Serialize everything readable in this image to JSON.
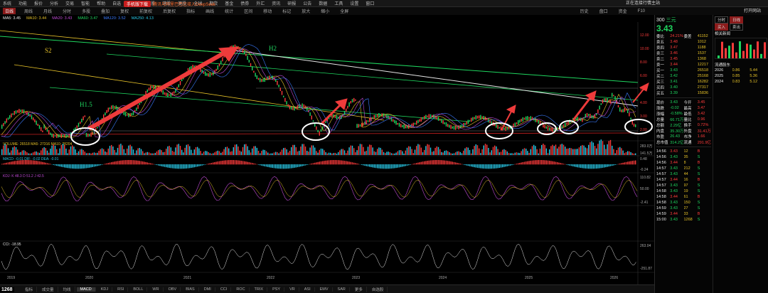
{
  "menubar": {
    "items": [
      "系统",
      "功能",
      "报价",
      "分析",
      "交易",
      "智能",
      "帮助",
      "自选",
      "沪深京",
      "A股",
      "港股",
      "美股",
      "全球",
      "期货",
      "基金",
      "债券",
      "外汇",
      "资讯",
      "研报",
      "公告",
      "数据",
      "工具",
      "设置",
      "窗口"
    ],
    "news_pill": "手机版下载",
    "news_text": "腾讯与阿里巴巴已接入DeepSeek",
    "window_title": "正在连接行情主站"
  },
  "toolbar": {
    "items": [
      "日线",
      "周线",
      "月线",
      "分时",
      "多股",
      "叠加",
      "复权",
      "前复权",
      "后复权",
      "指标",
      "画线",
      "统计",
      "区间",
      "移动",
      "标记",
      "放大",
      "缩小",
      "全屏"
    ],
    "active": "日线",
    "right_items": [
      "历史",
      "盘口",
      "资金",
      "F10"
    ],
    "right_title": "打开网站"
  },
  "ma_strip": [
    {
      "label": "MA5: 3.45",
      "color": "#e8e8e8"
    },
    {
      "label": "MA10: 3.44",
      "color": "#e6c229"
    },
    {
      "label": "MA20: 3.43",
      "color": "#c04bd6"
    },
    {
      "label": "MA60: 3.47",
      "color": "#1fd65f"
    },
    {
      "label": "MA120: 3.52",
      "color": "#3a7bff"
    },
    {
      "label": "MA250: 4.13",
      "color": "#29c7e6"
    }
  ],
  "chart_labels": {
    "s2": "S2",
    "h2": "H2",
    "h15": "H1.5"
  },
  "x_axis": [
    "2019",
    "2020",
    "2021",
    "2022",
    "2023",
    "2024",
    "2025",
    "2026"
  ],
  "price_axis": [
    "12.00",
    "10.00",
    "8.00",
    "6.00",
    "5.00",
    "4.00",
    "3.00",
    "2.00"
  ],
  "panel_labels": {
    "vol": "VOLUME: 26518  MA5: 27316  MA10: 28204",
    "macd": "MACD: -0.01  DIF: -0.02  DEA: -0.01",
    "kdj": "KDJ: K 48.3  D 51.2  J 42.5",
    "cci": "CCI: -18.95"
  },
  "panel_axes": {
    "vol": [
      "283.0万",
      "141.5万"
    ],
    "macd": [
      "0.48",
      "-0.24"
    ],
    "kdj": [
      "110.82",
      "50.00",
      "-2.41"
    ],
    "cci": [
      "263.04",
      "-251.87"
    ]
  },
  "bottom_tabs": [
    "指标",
    "成交量",
    "均线",
    "MACD",
    "KDJ",
    "RSI",
    "BOLL",
    "WR",
    "OBV",
    "BIAS",
    "DMI",
    "CCI",
    "ROC",
    "TRIX",
    "PSY",
    "VR",
    "ASI",
    "EMV",
    "SAR",
    "更多",
    "自选股"
  ],
  "bottom_active": "MACD",
  "code_tag": "1268",
  "side": {
    "code": "300",
    "name": "三元",
    "price": "3.43",
    "rows_a": [
      [
        "委比",
        "24.21%",
        "委差",
        "41152"
      ],
      [
        "卖五",
        "3.48",
        "",
        "1012"
      ],
      [
        "卖四",
        "3.47",
        "",
        "1188"
      ],
      [
        "卖三",
        "3.46",
        "",
        "1537"
      ],
      [
        "卖二",
        "3.45",
        "",
        "1368"
      ],
      [
        "卖一",
        "3.44",
        "",
        "12217"
      ],
      [
        "买一",
        "3.43",
        "",
        "26518"
      ],
      [
        "买二",
        "3.42",
        "",
        "25168"
      ],
      [
        "买三",
        "3.41",
        "",
        "16282"
      ],
      [
        "买四",
        "3.40",
        "",
        "27317"
      ],
      [
        "买五",
        "3.39",
        "",
        "15836"
      ]
    ],
    "quote_rows": [
      [
        "现价",
        "3.43",
        "今开",
        "3.45"
      ],
      [
        "涨跌",
        "-0.02",
        "最高",
        "3.47"
      ],
      [
        "涨幅",
        "-0.58%",
        "最低",
        "3.42"
      ],
      [
        "总量",
        "66.71万",
        "量比",
        "0.96"
      ],
      [
        "总额",
        "2.29亿",
        "换手",
        "0.72%"
      ],
      [
        "内盘",
        "35.30万",
        "外盘",
        "31.41万"
      ],
      [
        "市盈",
        "26.43",
        "市净",
        "1.66"
      ],
      [
        "总市值",
        "314.2亿",
        "流通",
        "291.9亿"
      ]
    ],
    "fin_rows": [
      [
        "2026",
        "0.86",
        "5.44"
      ],
      [
        "2025",
        "0.85",
        "5.36"
      ],
      [
        "2024",
        "0.83",
        "5.12"
      ]
    ],
    "ticks": [
      [
        "14:56",
        "3.43",
        "12",
        "B"
      ],
      [
        "14:56",
        "3.43",
        "35",
        "S"
      ],
      [
        "14:56",
        "3.44",
        "8",
        "B"
      ],
      [
        "14:57",
        "3.43",
        "212",
        "S"
      ],
      [
        "14:57",
        "3.43",
        "44",
        "S"
      ],
      [
        "14:57",
        "3.44",
        "16",
        "B"
      ],
      [
        "14:57",
        "3.43",
        "97",
        "S"
      ],
      [
        "14:58",
        "3.43",
        "19",
        "S"
      ],
      [
        "14:58",
        "3.44",
        "61",
        "B"
      ],
      [
        "14:58",
        "3.43",
        "150",
        "S"
      ],
      [
        "14:59",
        "3.43",
        "27",
        "S"
      ],
      [
        "14:59",
        "3.44",
        "33",
        "B"
      ],
      [
        "15:00",
        "3.43",
        "1268",
        "S"
      ]
    ],
    "buttons_a": [
      "分时",
      "日线"
    ],
    "buttons_b": [
      "买入",
      "卖出"
    ],
    "news_title": "相关新闻",
    "mini_title": "流通股东"
  },
  "colors": {
    "up": "#ff3b3b",
    "down": "#1fd65f",
    "accent": "#8b1b1b"
  }
}
